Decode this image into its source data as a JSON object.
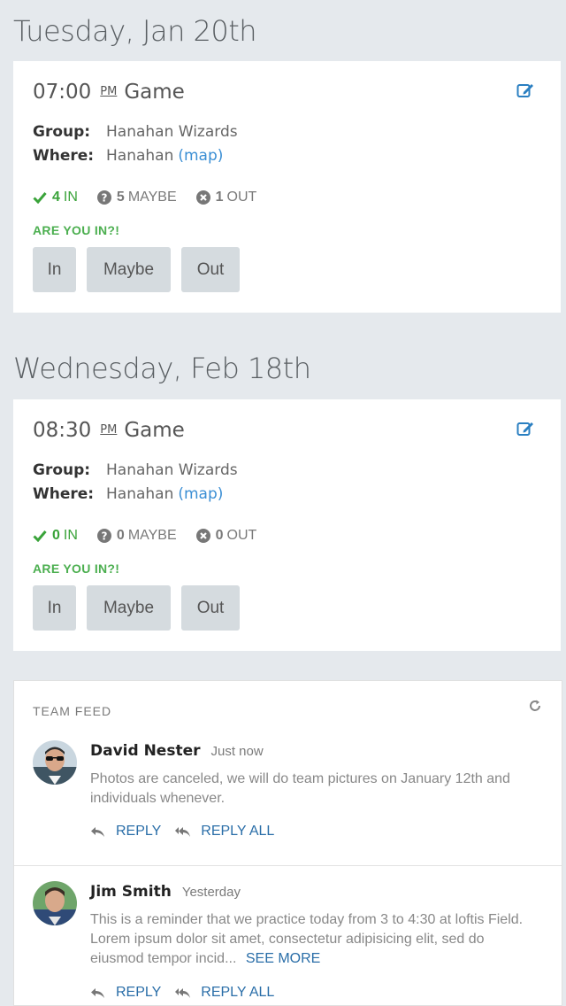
{
  "events": [
    {
      "date_heading": "Tuesday, Jan 20th",
      "time": "07:00",
      "ampm": "PM",
      "name": "Game",
      "group_label": "Group:",
      "group_value": "Hanahan Wizards",
      "where_label": "Where:",
      "where_value": "Hanahan",
      "map_link": "(map)",
      "in_count": "4",
      "in_label": "IN",
      "maybe_count": "5",
      "maybe_label": "MAYBE",
      "out_count": "1",
      "out_label": "OUT",
      "prompt": "ARE YOU IN?!",
      "buttons": {
        "in": "In",
        "maybe": "Maybe",
        "out": "Out"
      }
    },
    {
      "date_heading": "Wednesday, Feb 18th",
      "time": "08:30",
      "ampm": "PM",
      "name": "Game",
      "group_label": "Group:",
      "group_value": "Hanahan Wizards",
      "where_label": "Where:",
      "where_value": "Hanahan",
      "map_link": "(map)",
      "in_count": "0",
      "in_label": "IN",
      "maybe_count": "0",
      "maybe_label": "MAYBE",
      "out_count": "0",
      "out_label": "OUT",
      "prompt": "ARE YOU IN?!",
      "buttons": {
        "in": "In",
        "maybe": "Maybe",
        "out": "Out"
      }
    }
  ],
  "feed": {
    "title": "TEAM FEED",
    "posts": [
      {
        "author": "David Nester",
        "time": "Just now",
        "body": "Photos are canceled, we will do team pictures on January 12th and individuals whenever.",
        "reply": "REPLY",
        "reply_all": "REPLY ALL"
      },
      {
        "author": "Jim Smith",
        "time": "Yesterday",
        "body": "This is a reminder that we practice today from 3 to 4:30 at loftis Field. Lorem ipsum dolor sit amet, consectetur adipisicing elit, sed do eiusmod tempor incid...",
        "see_more": "SEE MORE",
        "reply": "REPLY",
        "reply_all": "REPLY ALL"
      }
    ]
  },
  "colors": {
    "background": "#e5e9ed",
    "accent_green": "#4caf50",
    "link_blue": "#2a6ea8",
    "button_gray": "#d5dbdf"
  },
  "icons": [
    "edit-icon",
    "check-icon",
    "question-icon",
    "x-circle-icon",
    "refresh-icon",
    "reply-icon",
    "reply-all-icon"
  ]
}
